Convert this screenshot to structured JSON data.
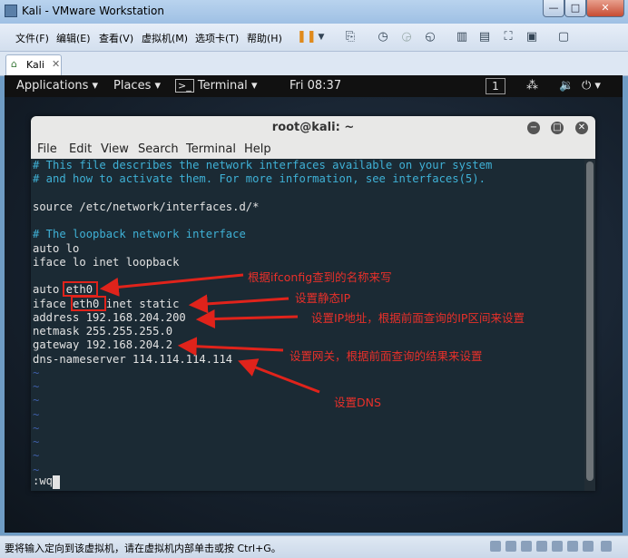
{
  "vmware": {
    "title": "Kali - VMware Workstation",
    "menu": [
      "文件(F)",
      "编辑(E)",
      "查看(V)",
      "虚拟机(M)",
      "选项卡(T)",
      "帮助(H)"
    ],
    "tab_label": "Kali",
    "status_text": "要将输入定向到该虚拟机，请在虚拟机内部单击或按 Ctrl+G。"
  },
  "kali_panel": {
    "applications": "Applications",
    "places": "Places",
    "terminal": "Terminal",
    "clock": "Fri 08:37",
    "workspace": "1"
  },
  "terminal": {
    "title": "root@kali: ~",
    "menu": [
      "File",
      "Edit",
      "View",
      "Search",
      "Terminal",
      "Help"
    ],
    "lines": [
      "# This file describes the network interfaces available on your system",
      "# and how to activate them. For more information, see interfaces(5).",
      "",
      "source /etc/network/interfaces.d/*",
      "",
      "# The loopback network interface",
      "auto lo",
      "iface lo inet loopback",
      "",
      "auto eth0",
      "iface eth0 inet static",
      "address 192.168.204.200",
      "netmask 255.255.255.0",
      "gateway 192.168.204.2",
      "dns-nameserver 114.114.114.114",
      "~",
      "~",
      "~",
      "~",
      "~",
      "~",
      "~",
      "~"
    ],
    "command_line": ":wq"
  },
  "annotations": {
    "name_note": "根据ifconfig查到的名称来写",
    "static_note": "设置静态IP",
    "ip_note": "设置IP地址，根据前面查询的IP区间来设置",
    "gateway_note": "设置网关，根据前面查询的结果来设置",
    "dns_note": "设置DNS"
  }
}
